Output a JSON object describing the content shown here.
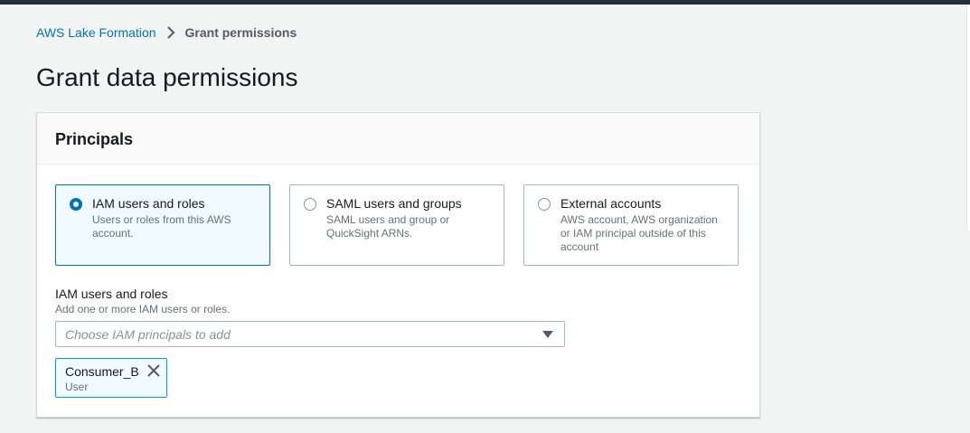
{
  "breadcrumb": {
    "parent": "AWS Lake Formation",
    "current": "Grant permissions"
  },
  "page_title": "Grant data permissions",
  "principals": {
    "heading": "Principals",
    "options": [
      {
        "title": "IAM users and roles",
        "description": "Users or roles from this AWS account.",
        "selected": true
      },
      {
        "title": "SAML users and groups",
        "description": "SAML users and group or QuickSight ARNs.",
        "selected": false
      },
      {
        "title": "External accounts",
        "description": "AWS account, AWS organization or IAM principal outside of this account",
        "selected": false
      }
    ],
    "field": {
      "label": "IAM users and roles",
      "description": "Add one or more IAM users or roles.",
      "placeholder": "Choose IAM principals to add"
    },
    "tokens": [
      {
        "name": "Consumer_B",
        "type": "User"
      }
    ]
  },
  "colors": {
    "accent": "#0073bb",
    "topbar": "#232f3e",
    "background": "#f2f3f3"
  },
  "icons": {
    "breadcrumb_separator": "chevron-right-icon",
    "dropdown": "caret-down-icon",
    "token_remove": "close-icon"
  }
}
